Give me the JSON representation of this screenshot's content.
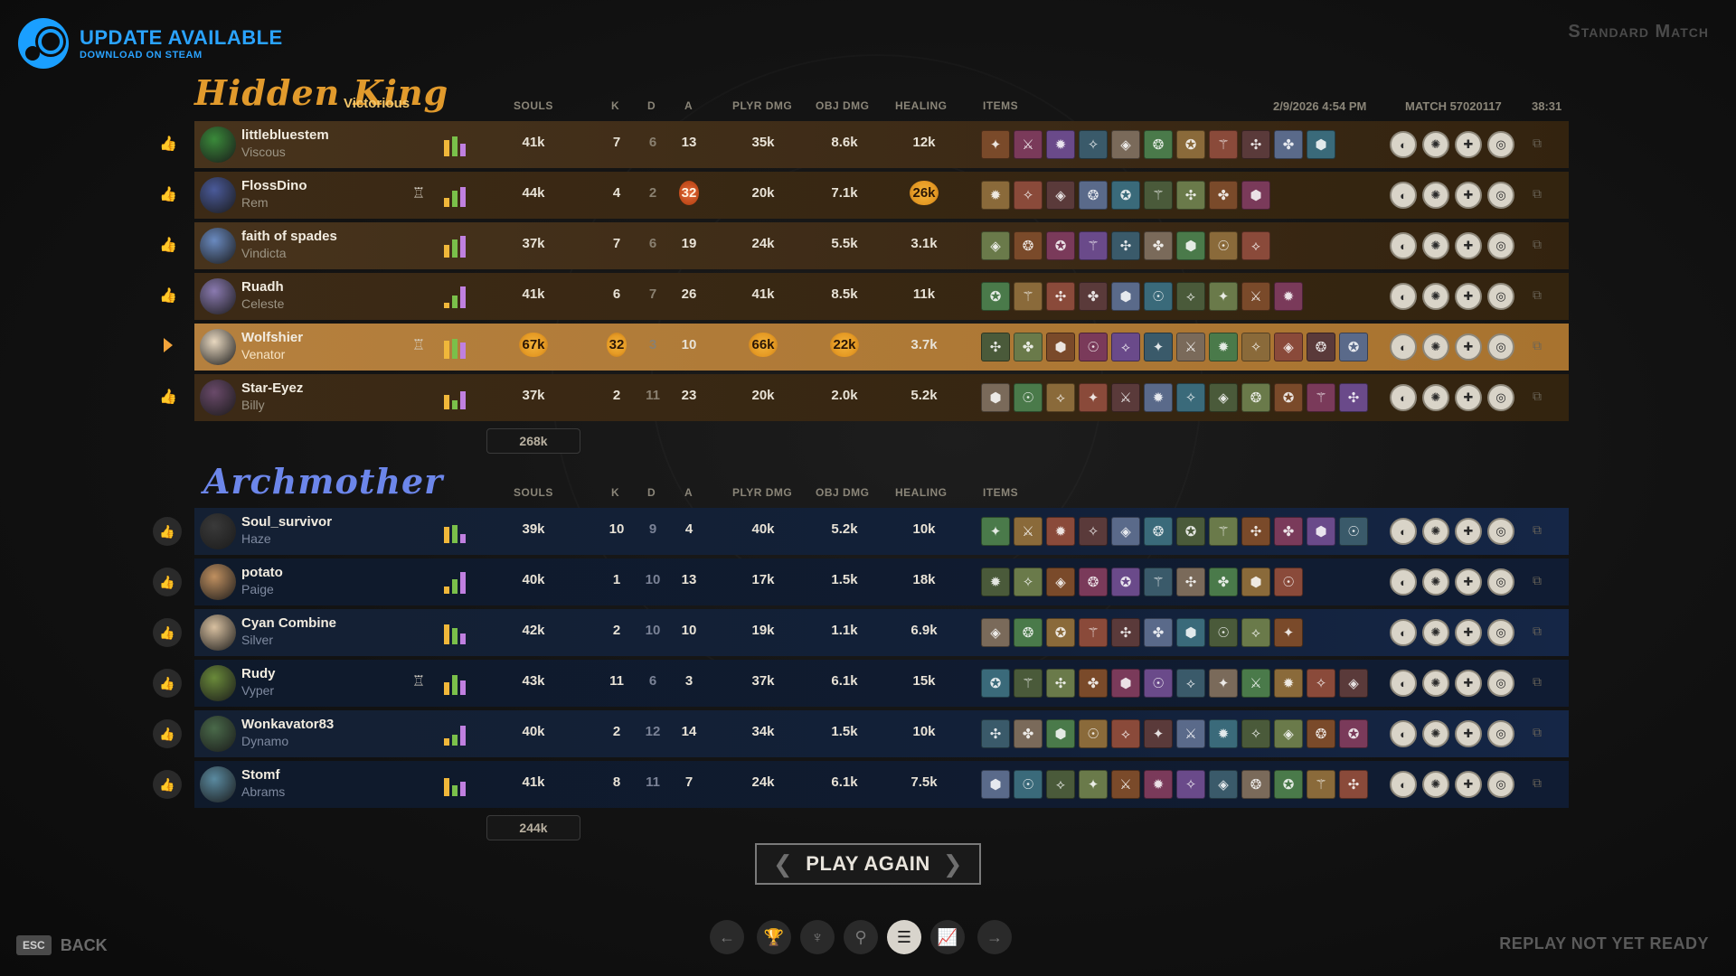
{
  "header": {
    "update_title": "UPDATE AVAILABLE",
    "update_sub": "DOWNLOAD ON STEAM",
    "match_type": "Standard Match",
    "date": "2/9/2026 4:54 PM",
    "match_id": "MATCH 57020117",
    "duration": "38:31"
  },
  "teams": {
    "hidden_king": {
      "name": "Hidden King",
      "result": "Victorious",
      "total_souls": "268k"
    },
    "archmother": {
      "name": "Archmother",
      "total_souls": "244k"
    }
  },
  "columns": {
    "souls": "SOULS",
    "k": "K",
    "d": "D",
    "a": "A",
    "plyr_dmg": "PLYR DMG",
    "obj_dmg": "OBJ DMG",
    "healing": "HEALING",
    "items": "ITEMS"
  },
  "rows": {
    "hk": [
      {
        "player": "littlebluestem",
        "hero": "Viscous",
        "souls": "41k",
        "k": "7",
        "d": "6",
        "a": "13",
        "pd": "35k",
        "od": "8.6k",
        "heal": "12k"
      },
      {
        "player": "FlossDino",
        "hero": "Rem",
        "souls": "44k",
        "k": "4",
        "d": "2",
        "a": "32",
        "pd": "20k",
        "od": "7.1k",
        "heal": "26k"
      },
      {
        "player": "faith of spades",
        "hero": "Vindicta",
        "souls": "37k",
        "k": "7",
        "d": "6",
        "a": "19",
        "pd": "24k",
        "od": "5.5k",
        "heal": "3.1k"
      },
      {
        "player": "Ruadh",
        "hero": "Celeste",
        "souls": "41k",
        "k": "6",
        "d": "7",
        "a": "26",
        "pd": "41k",
        "od": "8.5k",
        "heal": "11k"
      },
      {
        "player": "Wolfshier",
        "hero": "Venator",
        "souls": "67k",
        "k": "32",
        "d": "3",
        "a": "10",
        "pd": "66k",
        "od": "22k",
        "heal": "3.7k"
      },
      {
        "player": "Star-Eyez",
        "hero": "Billy",
        "souls": "37k",
        "k": "2",
        "d": "11",
        "a": "23",
        "pd": "20k",
        "od": "2.0k",
        "heal": "5.2k"
      }
    ],
    "am": [
      {
        "player": "Soul_survivor",
        "hero": "Haze",
        "souls": "39k",
        "k": "10",
        "d": "9",
        "a": "4",
        "pd": "40k",
        "od": "5.2k",
        "heal": "10k"
      },
      {
        "player": "potato",
        "hero": "Paige",
        "souls": "40k",
        "k": "1",
        "d": "10",
        "a": "13",
        "pd": "17k",
        "od": "1.5k",
        "heal": "18k"
      },
      {
        "player": "Cyan Combine",
        "hero": "Silver",
        "souls": "42k",
        "k": "2",
        "d": "10",
        "a": "10",
        "pd": "19k",
        "od": "1.1k",
        "heal": "6.9k"
      },
      {
        "player": "Rudy",
        "hero": "Vyper",
        "souls": "43k",
        "k": "11",
        "d": "6",
        "a": "3",
        "pd": "37k",
        "od": "6.1k",
        "heal": "15k"
      },
      {
        "player": "Wonkavator83",
        "hero": "Dynamo",
        "souls": "40k",
        "k": "2",
        "d": "12",
        "a": "14",
        "pd": "34k",
        "od": "1.5k",
        "heal": "10k"
      },
      {
        "player": "Stomf",
        "hero": "Abrams",
        "souls": "41k",
        "k": "8",
        "d": "11",
        "a": "7",
        "pd": "24k",
        "od": "6.1k",
        "heal": "7.5k"
      }
    ]
  },
  "buttons": {
    "play_again": "PLAY AGAIN",
    "back": "BACK",
    "esc": "ESC"
  },
  "footer": {
    "replay": "REPLAY NOT YET READY"
  },
  "colors": {
    "amber": "#3c2a16",
    "selected": "#b5803e",
    "blue": "#142033",
    "accent_blue": "#2aa3ff",
    "gold": "#e19a2c"
  }
}
